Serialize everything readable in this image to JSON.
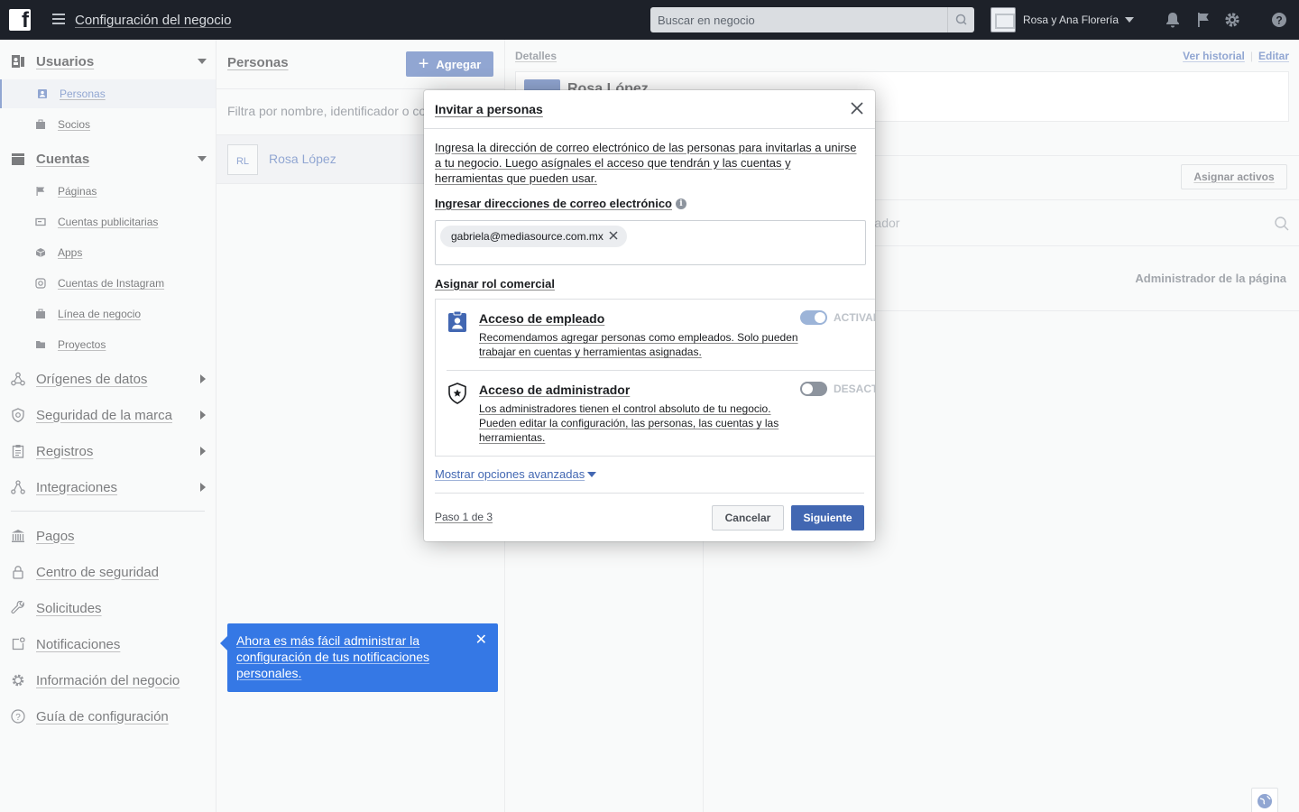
{
  "topbar": {
    "title": "Configuración del negocio",
    "search_placeholder": "Buscar en negocio",
    "business_name": "Rosa y Ana Florería",
    "icons": [
      "bell-icon",
      "flag-icon",
      "gear-icon",
      "help-icon"
    ]
  },
  "sidebar": {
    "sections": [
      {
        "label": "Usuarios",
        "icon": "users-icon",
        "expanded": true,
        "items": [
          {
            "label": "Personas",
            "icon": "person-badge-icon",
            "active": true
          },
          {
            "label": "Socios",
            "icon": "briefcase-icon",
            "active": false
          }
        ]
      },
      {
        "label": "Cuentas",
        "icon": "accounts-icon",
        "expanded": true,
        "items": [
          {
            "label": "Páginas",
            "icon": "flag-icon"
          },
          {
            "label": "Cuentas publicitarias",
            "icon": "ad-account-icon"
          },
          {
            "label": "Apps",
            "icon": "cube-icon"
          },
          {
            "label": "Cuentas de Instagram",
            "icon": "instagram-icon"
          },
          {
            "label": "Línea de negocio",
            "icon": "briefcase-icon"
          },
          {
            "label": "Proyectos",
            "icon": "folder-icon"
          }
        ]
      },
      {
        "label": "Orígenes de datos",
        "icon": "data-sources-icon"
      },
      {
        "label": "Seguridad de la marca",
        "icon": "shield-icon"
      },
      {
        "label": "Registros",
        "icon": "clipboard-icon"
      },
      {
        "label": "Integraciones",
        "icon": "integrations-icon"
      }
    ],
    "bottom": [
      {
        "label": "Pagos",
        "icon": "bank-icon"
      },
      {
        "label": "Centro de seguridad",
        "icon": "lock-icon"
      },
      {
        "label": "Solicitudes",
        "icon": "wrench-icon"
      },
      {
        "label": "Notificaciones",
        "icon": "notification-icon"
      },
      {
        "label": "Información del negocio",
        "icon": "gear-icon"
      },
      {
        "label": "Guía de configuración",
        "icon": "question-circle-icon"
      }
    ]
  },
  "personas": {
    "heading": "Personas",
    "add_label": "Agregar",
    "filter_placeholder": "Filtra por nombre, identificador o correo",
    "people": [
      {
        "initials": "RL",
        "name": "Rosa López"
      }
    ]
  },
  "tip": {
    "text": "Ahora es más fácil administrar la configuración de tus notificaciones personales."
  },
  "details": {
    "label": "Detalles",
    "view_history": "Ver historial",
    "edit": "Editar",
    "name": "Rosa López",
    "assign_assets": "Asignar activos",
    "asset_search_placeholder": "Busca por nombre o identificador",
    "asset_role": "Administrador de la página"
  },
  "modal": {
    "title": "Invitar a personas",
    "intro": "Ingresa la dirección de correo electrónico de las personas para invitarlas a unirse a tu negocio. Luego asígnales el acceso que tendrán y las cuentas y herramientas que pueden usar.",
    "emails_label": "Ingresar direcciones de correo electrónico",
    "email_chip": "gabriela@mediasource.com.mx",
    "role_label": "Asignar rol comercial",
    "roles": [
      {
        "title": "Acceso de empleado",
        "desc": "Recomendamos agregar personas como empleados. Solo pueden trabajar en cuentas y herramientas asignadas.",
        "state_label": "ACTIVADO",
        "on": true
      },
      {
        "title": "Acceso de administrador",
        "desc": "Los administradores tienen el control absoluto de tu negocio. Pueden editar la configuración, las personas, las cuentas y las herramientas.",
        "state_label": "DESACTIVADO",
        "on": false
      }
    ],
    "advanced_link": "Mostrar opciones avanzadas",
    "step": "Paso 1 de 3",
    "cancel": "Cancelar",
    "next": "Siguiente"
  },
  "colors": {
    "topbar": "#1d2129",
    "accent": "#4267b2",
    "tip": "#3578e5",
    "sidebar_bg": "#f5f6f7"
  }
}
